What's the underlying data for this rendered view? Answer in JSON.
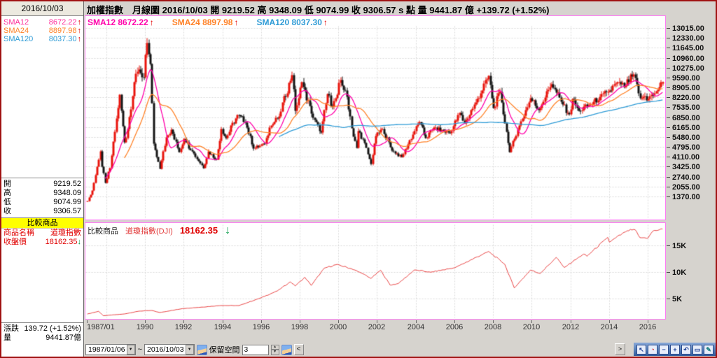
{
  "window": {
    "header": "加權指數　月線圖  2016/10/03  開 9219.52  高 9348.09  低 9074.99  收 9306.57 s 點  量 9441.87 億  +139.72 (+1.52%)"
  },
  "colors": {
    "panel_border": "#ff7cf5",
    "grid": "#d9d9d9",
    "up_candle": "#e8140c",
    "down_candle": "#161616",
    "sma12": "#ff00aa",
    "sma24": "#ff8228",
    "sma120": "#2e9bd6",
    "dow_line": "#e84040",
    "red_text": "#e00000",
    "green_arrow": "#009944",
    "yellow_header": "#ffff00"
  },
  "sidebar": {
    "date": "2016/10/03",
    "sma": [
      {
        "label": "SMA12",
        "value": "8672.22",
        "arrow": "↑",
        "color": "#ff2d9b"
      },
      {
        "label": "SMA24",
        "value": "8897.98",
        "arrow": "↑",
        "color": "#ff8228"
      },
      {
        "label": "SMA120",
        "value": "8037.30",
        "arrow": "↑",
        "color": "#2e9bd6"
      }
    ],
    "ohlc": [
      {
        "label": "開",
        "value": "9219.52"
      },
      {
        "label": "高",
        "value": "9348.09"
      },
      {
        "label": "低",
        "value": "9074.99"
      },
      {
        "label": "收",
        "value": "9306.57"
      }
    ],
    "compare_header": "比較商品",
    "compare_rows": [
      {
        "label": "商品名稱",
        "value": "道瓊指數",
        "arrow": ""
      },
      {
        "label": "收盤價",
        "value": "18162.35",
        "arrow": "↓"
      }
    ],
    "change_label": "漲跌",
    "change_value": "139.72 (+1.52%)",
    "volume_label": "量",
    "volume_value": "9441.87億"
  },
  "legend": {
    "arrow": "↑",
    "items": [
      {
        "text": "SMA12 8672.22",
        "color": "#ff00aa"
      },
      {
        "text": "SMA24 8897.98",
        "color": "#ff8228"
      },
      {
        "text": "SMA120 8037.30",
        "color": "#2e9bd6"
      }
    ]
  },
  "compare_panel": {
    "label": "比較商品",
    "name": "道瓊指數(DJI)",
    "value": "18162.35",
    "arrow": "↓"
  },
  "statusbar": {
    "start_date": "1987/01/06",
    "tilde": "~",
    "end_date": "2016/10/03",
    "dropdown_glyph": "▼",
    "reserve_label": "保留空間",
    "reserve_value": "3",
    "spin_up": "▲",
    "spin_down": "▼",
    "back_button": "<",
    "scroll_right": ">"
  },
  "toolbar": {
    "buttons": [
      {
        "name": "cursor-icon",
        "glyph": "↖",
        "color": "#1c3f94"
      },
      {
        "name": "clock-icon",
        "glyph": "◔",
        "color": "#cc1111"
      },
      {
        "name": "zoom-out-icon",
        "glyph": "−",
        "color": "#1c3f94"
      },
      {
        "name": "zoom-in-icon",
        "glyph": "+",
        "color": "#1c3f94"
      },
      {
        "name": "undo-icon",
        "glyph": "↶",
        "color": "#1c3f94"
      },
      {
        "name": "frame-icon",
        "glyph": "▭",
        "color": "#1c3f94"
      },
      {
        "name": "pencil-icon",
        "glyph": "✎",
        "color": "#0f7a7a"
      }
    ]
  },
  "chart_data": [
    {
      "type": "candlestick",
      "title": "加權指數 月線圖 (TAIEX monthly)",
      "x_start": "1987/01",
      "x_end": "2016/10",
      "y_ticks": [
        13015,
        12330,
        11645,
        10960,
        10275,
        9590,
        8905,
        8220,
        7535,
        6850,
        6165,
        5480,
        4795,
        4110,
        3425,
        2740,
        2055,
        1370
      ],
      "x_tick_labels": [
        "1987/01",
        "1990",
        "1992",
        "1994",
        "1996",
        "1998",
        "2000",
        "2002",
        "2004",
        "2006",
        "2008",
        "2010",
        "2012",
        "2014",
        "2016"
      ],
      "up_color": "#e8140c",
      "down_color": "#161616",
      "series": [
        {
          "name": "SMA12",
          "window": 12,
          "color": "#ff00aa"
        },
        {
          "name": "SMA24",
          "window": 24,
          "color": "#ff8228"
        },
        {
          "name": "SMA120",
          "window": 120,
          "color": "#2e9bd6"
        }
      ],
      "anchors": [
        [
          "1987/01",
          1063
        ],
        [
          "1987/04",
          1800
        ],
        [
          "1987/09",
          4529
        ],
        [
          "1987/10",
          3460
        ],
        [
          "1987/12",
          2339
        ],
        [
          "1988/03",
          3373
        ],
        [
          "1988/09",
          8402
        ],
        [
          "1988/12",
          5119
        ],
        [
          "1989/02",
          6049
        ],
        [
          "1989/06",
          9308
        ],
        [
          "1989/09",
          10180
        ],
        [
          "1989/12",
          9624
        ],
        [
          "1990/02",
          11983
        ],
        [
          "1990/04",
          10530
        ],
        [
          "1990/06",
          5049
        ],
        [
          "1990/10",
          3318
        ],
        [
          "1990/12",
          4530
        ],
        [
          "1991/02",
          5500
        ],
        [
          "1991/05",
          6000
        ],
        [
          "1991/10",
          4460
        ],
        [
          "1992/01",
          5391
        ],
        [
          "1992/06",
          4524
        ],
        [
          "1992/11",
          3700
        ],
        [
          "1993/01",
          3375
        ],
        [
          "1993/04",
          4500
        ],
        [
          "1993/09",
          3950
        ],
        [
          "1993/12",
          6070
        ],
        [
          "1994/03",
          5415
        ],
        [
          "1994/10",
          7025
        ],
        [
          "1995/03",
          6510
        ],
        [
          "1995/08",
          4700
        ],
        [
          "1996/03",
          5032
        ],
        [
          "1996/06",
          6156
        ],
        [
          "1996/12",
          6934
        ],
        [
          "1997/02",
          7875
        ],
        [
          "1997/08",
          9757
        ],
        [
          "1997/10",
          7300
        ],
        [
          "1997/12",
          8187
        ],
        [
          "1998/02",
          9277
        ],
        [
          "1998/09",
          6833
        ],
        [
          "1999/02",
          5798
        ],
        [
          "1999/06",
          8467
        ],
        [
          "1999/09",
          7598
        ],
        [
          "1999/12",
          8448
        ],
        [
          "2000/02",
          9435
        ],
        [
          "2000/06",
          8265
        ],
        [
          "2000/10",
          5544
        ],
        [
          "2000/12",
          4739
        ],
        [
          "2001/01",
          5936
        ],
        [
          "2001/04",
          5350
        ],
        [
          "2001/09",
          3636
        ],
        [
          "2001/12",
          5551
        ],
        [
          "2002/04",
          6065
        ],
        [
          "2002/10",
          4579
        ],
        [
          "2003/04",
          4139
        ],
        [
          "2003/12",
          5890
        ],
        [
          "2004/03",
          6522
        ],
        [
          "2004/07",
          5420
        ],
        [
          "2004/12",
          6139
        ],
        [
          "2005/10",
          5764
        ],
        [
          "2006/04",
          7171
        ],
        [
          "2006/07",
          6454
        ],
        [
          "2007/02",
          7901
        ],
        [
          "2007/10",
          9711
        ],
        [
          "2008/01",
          7521
        ],
        [
          "2008/05",
          8619
        ],
        [
          "2008/11",
          4460
        ],
        [
          "2009/04",
          5992
        ],
        [
          "2009/12",
          8188
        ],
        [
          "2010/05",
          7374
        ],
        [
          "2010/12",
          8972
        ],
        [
          "2011/01",
          9145
        ],
        [
          "2011/08",
          7741
        ],
        [
          "2011/12",
          7072
        ],
        [
          "2012/02",
          8121
        ],
        [
          "2012/06",
          7296
        ],
        [
          "2012/12",
          7700
        ],
        [
          "2013/06",
          8062
        ],
        [
          "2013/12",
          8611
        ],
        [
          "2014/07",
          9315
        ],
        [
          "2014/10",
          8974
        ],
        [
          "2015/04",
          9820
        ],
        [
          "2015/08",
          8174
        ],
        [
          "2015/11",
          8320
        ],
        [
          "2016/01",
          8145
        ],
        [
          "2016/05",
          8535
        ],
        [
          "2016/10",
          9307
        ]
      ],
      "last_bar": {
        "date": "2016/10/03",
        "open": 9219.52,
        "high": 9348.09,
        "low": 9074.99,
        "close": 9306.57
      }
    },
    {
      "type": "line",
      "title": "比較商品 道瓊指數(DJI)",
      "name": "道瓊指數(DJI)",
      "color": "#e84040",
      "y_ticks": [
        {
          "value": 15000,
          "label": "15K"
        },
        {
          "value": 10000,
          "label": "10K"
        },
        {
          "value": 5000,
          "label": "5K"
        }
      ],
      "last_value": 18162.35,
      "anchors": [
        [
          "1987/01",
          2158
        ],
        [
          "1987/08",
          2663
        ],
        [
          "1987/11",
          1834
        ],
        [
          "1988/12",
          2169
        ],
        [
          "1989/09",
          2693
        ],
        [
          "1990/05",
          2820
        ],
        [
          "1990/10",
          2442
        ],
        [
          "1991/12",
          3169
        ],
        [
          "1993/12",
          3754
        ],
        [
          "1994/11",
          3739
        ],
        [
          "1995/12",
          5117
        ],
        [
          "1996/11",
          6522
        ],
        [
          "1997/07",
          8223
        ],
        [
          "1997/10",
          7442
        ],
        [
          "1998/04",
          9063
        ],
        [
          "1998/08",
          7539
        ],
        [
          "1999/04",
          10789
        ],
        [
          "1999/12",
          11497
        ],
        [
          "2000/09",
          10651
        ],
        [
          "2001/03",
          9879
        ],
        [
          "2001/09",
          8848
        ],
        [
          "2002/03",
          10404
        ],
        [
          "2002/09",
          7592
        ],
        [
          "2003/02",
          7891
        ],
        [
          "2003/12",
          10454
        ],
        [
          "2004/10",
          10027
        ],
        [
          "2006/01",
          10865
        ],
        [
          "2007/10",
          13930
        ],
        [
          "2008/08",
          11544
        ],
        [
          "2009/02",
          7063
        ],
        [
          "2009/12",
          10428
        ],
        [
          "2010/06",
          9774
        ],
        [
          "2011/04",
          12811
        ],
        [
          "2011/09",
          10913
        ],
        [
          "2012/09",
          13437
        ],
        [
          "2012/11",
          13026
        ],
        [
          "2013/12",
          16577
        ],
        [
          "2014/01",
          15699
        ],
        [
          "2014/12",
          17823
        ],
        [
          "2015/05",
          18011
        ],
        [
          "2015/08",
          16528
        ],
        [
          "2016/01",
          16466
        ],
        [
          "2016/04",
          17774
        ],
        [
          "2016/10",
          18162
        ]
      ]
    }
  ]
}
